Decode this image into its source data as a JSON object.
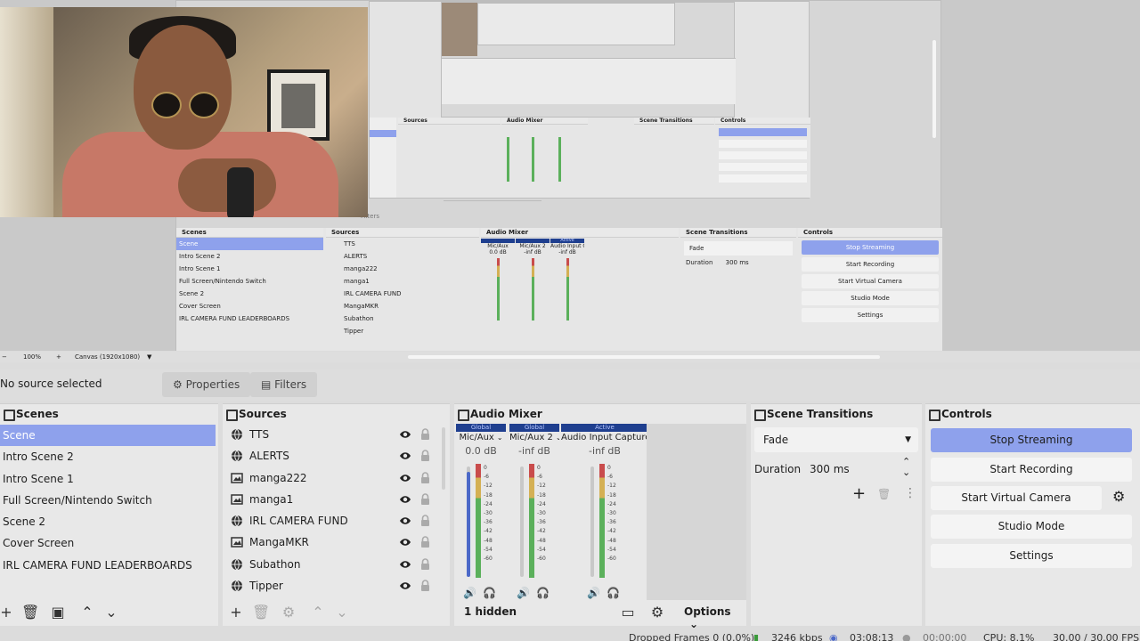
{
  "preview": {
    "zoom": "100%",
    "canvas": "Canvas (1920x1080)",
    "nested_filters": "Filters"
  },
  "mini_docks": {
    "scenes_title": "Scenes",
    "sources_title": "Sources",
    "mixer_title": "Audio Mixer",
    "transitions_title": "Scene Transitions",
    "controls_title": "Controls",
    "transition_value": "Fade",
    "duration_label": "Duration",
    "duration_value": "300 ms",
    "mixer_channels": [
      {
        "name": "Mic/Aux",
        "db": "0.0 dB"
      },
      {
        "name": "Mic/Aux 2",
        "db": "-inf dB"
      },
      {
        "name": "Audio Input Capture",
        "db": "-inf dB",
        "head": "Active"
      }
    ]
  },
  "propbar": {
    "no_source": "No source selected",
    "properties": "Properties",
    "filters": "Filters"
  },
  "scenes": {
    "title": "Scenes",
    "items": [
      "Scene",
      "Intro Scene 2",
      "Intro Scene 1",
      "Full Screen/Nintendo Switch",
      "Scene 2",
      "Cover Screen",
      "IRL CAMERA FUND LEADERBOARDS"
    ]
  },
  "sources": {
    "title": "Sources",
    "items": [
      {
        "label": "TTS",
        "icon": "browser-icon"
      },
      {
        "label": "ALERTS",
        "icon": "browser-icon"
      },
      {
        "label": "manga222",
        "icon": "image-icon"
      },
      {
        "label": "manga1",
        "icon": "image-icon"
      },
      {
        "label": "IRL CAMERA FUND",
        "icon": "browser-icon"
      },
      {
        "label": "MangaMKR",
        "icon": "image-icon"
      },
      {
        "label": "Subathon",
        "icon": "browser-icon"
      },
      {
        "label": "Tipper",
        "icon": "browser-icon"
      }
    ]
  },
  "mixer": {
    "title": "Audio Mixer",
    "hidden": "1 hidden",
    "options": "Options",
    "scale": [
      "0",
      "-6",
      "-12",
      "-18",
      "-24",
      "-30",
      "-36",
      "-42",
      "-48",
      "-54",
      "-60"
    ],
    "channels": [
      {
        "head": "Global",
        "name": "Mic/Aux",
        "db": "0.0 dB",
        "volume": 0.95
      },
      {
        "head": "Global",
        "name": "Mic/Aux 2",
        "db": "-inf dB",
        "volume": 0.0
      },
      {
        "head": "Active",
        "name": "Audio Input Capture",
        "db": "-inf dB",
        "volume": 0.0
      }
    ]
  },
  "transitions": {
    "title": "Scene Transitions",
    "value": "Fade",
    "duration_label": "Duration",
    "duration_value": "300 ms"
  },
  "controls": {
    "title": "Controls",
    "stop_streaming": "Stop Streaming",
    "start_recording": "Start Recording",
    "start_virtual_camera": "Start Virtual Camera",
    "studio_mode": "Studio Mode",
    "settings": "Settings"
  },
  "status": {
    "dropped_frames": "Dropped Frames 0 (0.0%)",
    "bitrate": "3246 kbps",
    "stream_time": "03:08:13",
    "rec_time": "00:00:00",
    "cpu": "CPU: 8.1%",
    "fps": "30.00 / 30.00 FPS"
  },
  "colors": {
    "accent": "#8ea1ec",
    "meter_green": "#5bb05b",
    "meter_yellow": "#d4b054",
    "meter_red": "#c94c4c",
    "fader_blue": "#4c69c8"
  }
}
